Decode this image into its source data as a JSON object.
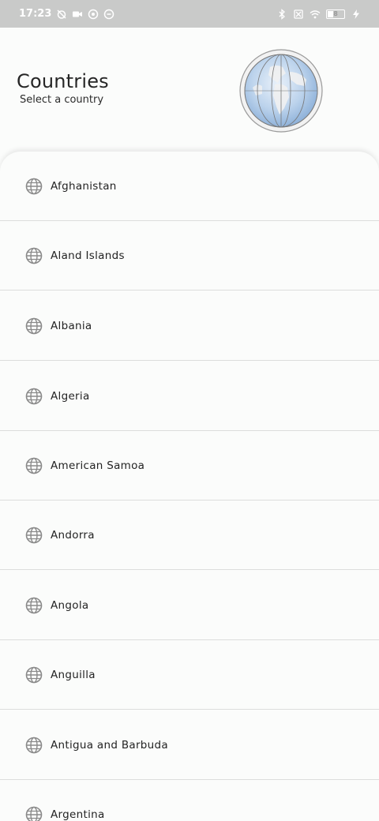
{
  "status_bar": {
    "time": "17:23",
    "left_icons": [
      "alarm-off-icon",
      "video-icon",
      "app-icon",
      "app-icon"
    ],
    "right_icons": [
      "bluetooth-icon",
      "sim-off-icon",
      "wifi-icon",
      "battery-icon",
      "charging-icon"
    ],
    "battery_level": "8"
  },
  "header": {
    "title": "Countries",
    "subtitle": "Select a country",
    "globe_icon": "globe-image"
  },
  "countries": [
    {
      "name": "Afghanistan",
      "icon": "globe-icon"
    },
    {
      "name": "Aland Islands",
      "icon": "globe-icon"
    },
    {
      "name": "Albania",
      "icon": "globe-icon"
    },
    {
      "name": "Algeria",
      "icon": "globe-icon"
    },
    {
      "name": "American Samoa",
      "icon": "globe-icon"
    },
    {
      "name": "Andorra",
      "icon": "globe-icon"
    },
    {
      "name": "Angola",
      "icon": "globe-icon"
    },
    {
      "name": "Anguilla",
      "icon": "globe-icon"
    },
    {
      "name": "Antigua and Barbuda",
      "icon": "globe-icon"
    },
    {
      "name": "Argentina",
      "icon": "globe-icon"
    }
  ],
  "colors": {
    "status_bar_bg": "#c9cac9",
    "background": "#fbfcfb",
    "divider": "#dcdddc",
    "icon": "#8a8a8a"
  }
}
